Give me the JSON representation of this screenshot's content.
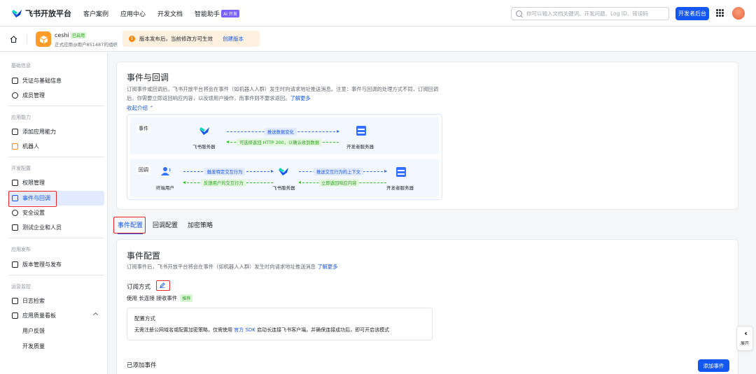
{
  "header": {
    "logo_text": "飞书开放平台",
    "nav": [
      "客户案例",
      "应用中心",
      "开发文档",
      "智能助手"
    ],
    "ai_badge": "AI 开发",
    "search_placeholder": "你可以输入文档关键词、开发问题、Log ID、错误码",
    "dev_console_label": "开发者后台"
  },
  "app": {
    "name": "ceshi",
    "status": "已启用",
    "subtitle": "正式应用@用户851487的组织",
    "notice_text": "版本发布后，当前修改方可生效",
    "notice_link": "创建版本"
  },
  "sidebar": {
    "sections": [
      "基础信息",
      "应用能力",
      "开发配置",
      "应用发布",
      "运营监控"
    ],
    "items": {
      "credentials": "凭证与基础信息",
      "members": "成员管理",
      "add_capability": "添加应用能力",
      "bot": "机器人",
      "permissions": "权限管理",
      "events": "事件与回调",
      "security": "安全设置",
      "test_tenant": "测试企业和人员",
      "version": "版本管理与发布",
      "logs": "日志检索",
      "quality": "应用质量看板",
      "feedback": "用户反馈",
      "dev_quality": "开发质量"
    }
  },
  "intro": {
    "title": "事件与回调",
    "desc": "订阅事件或回调后，飞书开放平台将会在事件（如机器人入群）发生时向请求地址推送消息。注意：事件与回调的处理方式不同，订阅回调后，你需要立即返回响应内容，以反馈用户操作，而事件则不要求返回。",
    "learn_more": "了解更多",
    "collapse": "收起介绍"
  },
  "diagram": {
    "event_tag": "事件",
    "callback_tag": "回调",
    "feishu_server": "飞书服务器",
    "dev_server": "开发者服务器",
    "end_user": "终端用户",
    "push_change": "推送数据变化",
    "http200": "可选择返回 HTTP 200，以确认收到数据",
    "trigger": "触发特定交互行为",
    "feedback": "反馈用户的交互行为",
    "push_context": "推送交互行为的上下文",
    "respond": "立即返回响应内容"
  },
  "tabs": [
    "事件配置",
    "回调配置",
    "加密策略"
  ],
  "event_config": {
    "title": "事件配置",
    "desc": "订阅事件后，飞书开放平台将会在事件（如机器人入群）发生时向请求地址推送消息",
    "learn_more": "了解更多",
    "sub_mode_title": "订阅方式",
    "mode_prefix": "使用 长连接 接收事件",
    "recommended": "推荐",
    "config_title": "配置方式",
    "config_desc_1": "无需注册公网域名或配置加密策略，仅需使用",
    "config_desc_link": "官方 SDK",
    "config_desc_2": "启动长连接飞书客户端，并确保连接成功后，即可开启该模式",
    "added_title": "已添加事件",
    "add_button": "添加事件"
  },
  "expand_label": "展开"
}
